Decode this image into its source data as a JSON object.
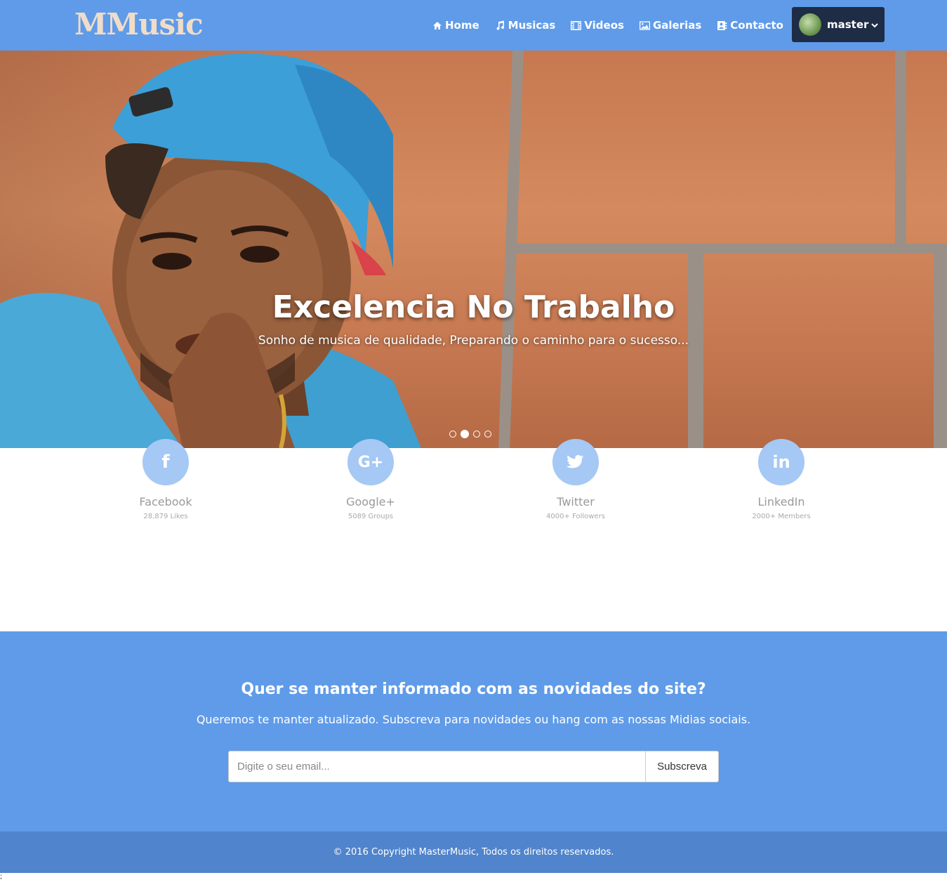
{
  "brand": "MMusic",
  "nav": {
    "items": [
      {
        "label": "Home",
        "icon": "home-icon"
      },
      {
        "label": "Musicas",
        "icon": "music-icon"
      },
      {
        "label": "Videos",
        "icon": "film-icon"
      },
      {
        "label": "Galerias",
        "icon": "image-icon"
      },
      {
        "label": "Contacto",
        "icon": "contact-icon"
      }
    ],
    "user": {
      "name": "master",
      "icon": "chevron-down-icon"
    }
  },
  "hero": {
    "title": "Excelencia No Trabalho",
    "subtitle": "Sonho de musica de qualidade, Preparando o caminho para o sucesso...",
    "slides": 4,
    "active_slide": 2
  },
  "social": [
    {
      "name": "Facebook",
      "count": "28,879 Likes",
      "icon": "facebook-icon",
      "glyph": "f"
    },
    {
      "name": "Google+",
      "count": "5089 Groups",
      "icon": "google-plus-icon",
      "glyph": "G+"
    },
    {
      "name": "Twitter",
      "count": "4000+ Followers",
      "icon": "twitter-icon",
      "glyph": "🐦"
    },
    {
      "name": "LinkedIn",
      "count": "2000+ Members",
      "icon": "linkedin-icon",
      "glyph": "in"
    }
  ],
  "newsletter": {
    "title": "Quer se manter informado com as novidades do site?",
    "text": "Queremos te manter atualizado. Subscreva para novidades ou hang com as nossas Midias sociais.",
    "placeholder": "Digite o seu email...",
    "button": "Subscreva"
  },
  "footer": {
    "text": "© 2016 Copyright MasterMusic,  Todos os direitos reservados."
  },
  "stray": ";",
  "colors": {
    "primary": "#5f9be8",
    "footer": "#5084cc",
    "user_button": "#1e2c45",
    "social_circle": "#a5c8f5"
  }
}
